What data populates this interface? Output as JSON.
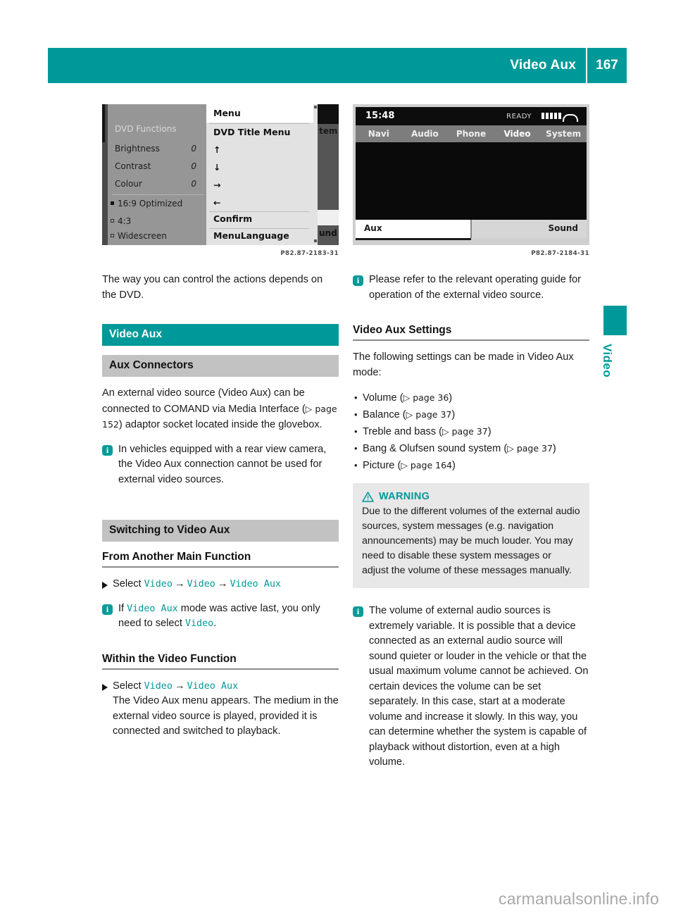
{
  "header": {
    "title": "Video Aux",
    "page_number": "167",
    "accent_color": "#009999"
  },
  "edge_tab": {
    "label": "Video"
  },
  "footer": {
    "watermark": "carmanualsonline.info"
  },
  "figures": {
    "left": {
      "caption": "P82.87-2183-31",
      "menu_panel": {
        "title": "DVD Functions",
        "rows": [
          {
            "label": "Brightness",
            "value": "0"
          },
          {
            "label": "Contrast",
            "value": "0"
          },
          {
            "label": "Colour",
            "value": "0"
          }
        ],
        "options": [
          {
            "label": "16:9 Optimized",
            "selected": "on"
          },
          {
            "label": "4:3",
            "selected": "off"
          },
          {
            "label": "Widescreen",
            "selected": "off"
          }
        ]
      },
      "submenu_panel": {
        "header": "Menu",
        "items": [
          "DVD Title Menu",
          "↑",
          "↓",
          "→",
          "←",
          "Confirm",
          "MenuLanguage"
        ]
      },
      "background_panel": {
        "label_top": "tem",
        "label_bottom": "und"
      }
    },
    "right": {
      "caption": "P82.87-2184-31",
      "status": {
        "clock": "15:48",
        "ready": "READY"
      },
      "menu_items": [
        "Navi",
        "Audio",
        "Phone",
        "Video",
        "System"
      ],
      "active_menu_item": "Video",
      "soft_keys": {
        "left": "Aux",
        "right": "Sound"
      }
    }
  },
  "left_column": {
    "intro": "The way you can control the actions depends on the DVD.",
    "section_band": "Video Aux",
    "aux_connectors": {
      "band": "Aux Connectors",
      "paragraph_1": "An external video source (Video Aux) can be connected to COMAND via Media Interface (",
      "page_ref": "▷ page 152",
      "paragraph_2": ") adaptor socket located inside the glovebox.",
      "note": "In vehicles equipped with a rear view camera, the Video Aux connection cannot be used for external video sources."
    },
    "switching": {
      "band": "Switching to Video Aux",
      "from_another": {
        "heading": "From Another Main Function",
        "step_prefix": "Select",
        "step_path": [
          "Video",
          "Video",
          "Video Aux"
        ],
        "note_pre": "If",
        "note_mono_1": "Video Aux",
        "note_mid": "mode was active last, you only need to select",
        "note_mono_2": "Video",
        "note_end": "."
      },
      "within": {
        "heading": "Within the Video Function",
        "step_prefix": "Select",
        "step_path": [
          "Video",
          "Video Aux"
        ],
        "body": "The Video Aux menu appears. The medium in the external video source is played, provided it is connected and switched to playback."
      }
    }
  },
  "right_column": {
    "note_top": "Please refer to the relevant operating guide for operation of the external video source.",
    "settings": {
      "heading": "Video Aux Settings",
      "intro": "The following settings can be made in Video Aux mode:",
      "items": [
        {
          "label": "Volume",
          "ref": "▷ page 36"
        },
        {
          "label": "Balance",
          "ref": "▷ page 37"
        },
        {
          "label": "Treble and bass",
          "ref": "▷ page 37"
        },
        {
          "label": "Bang & Olufsen sound system",
          "ref": "▷ page 37"
        },
        {
          "label": "Picture",
          "ref": "▷ page 164"
        }
      ]
    },
    "warning": {
      "label": "WARNING",
      "body": "Due to the different volumes of the external audio sources, system messages (e.g. navigation announcements) may be much louder. You may need to disable these system messages or adjust the volume of these messages manually."
    },
    "note_bottom": "The volume of external audio sources is extremely variable. It is possible that a device connected as an external audio source will sound quieter or louder in the vehicle or that the usual maximum volume cannot be achieved. On certain devices the volume can be set separately. In this case, start at a moderate volume and increase it slowly. In this way, you can determine whether the system is capable of playback without distortion, even at a high volume."
  }
}
